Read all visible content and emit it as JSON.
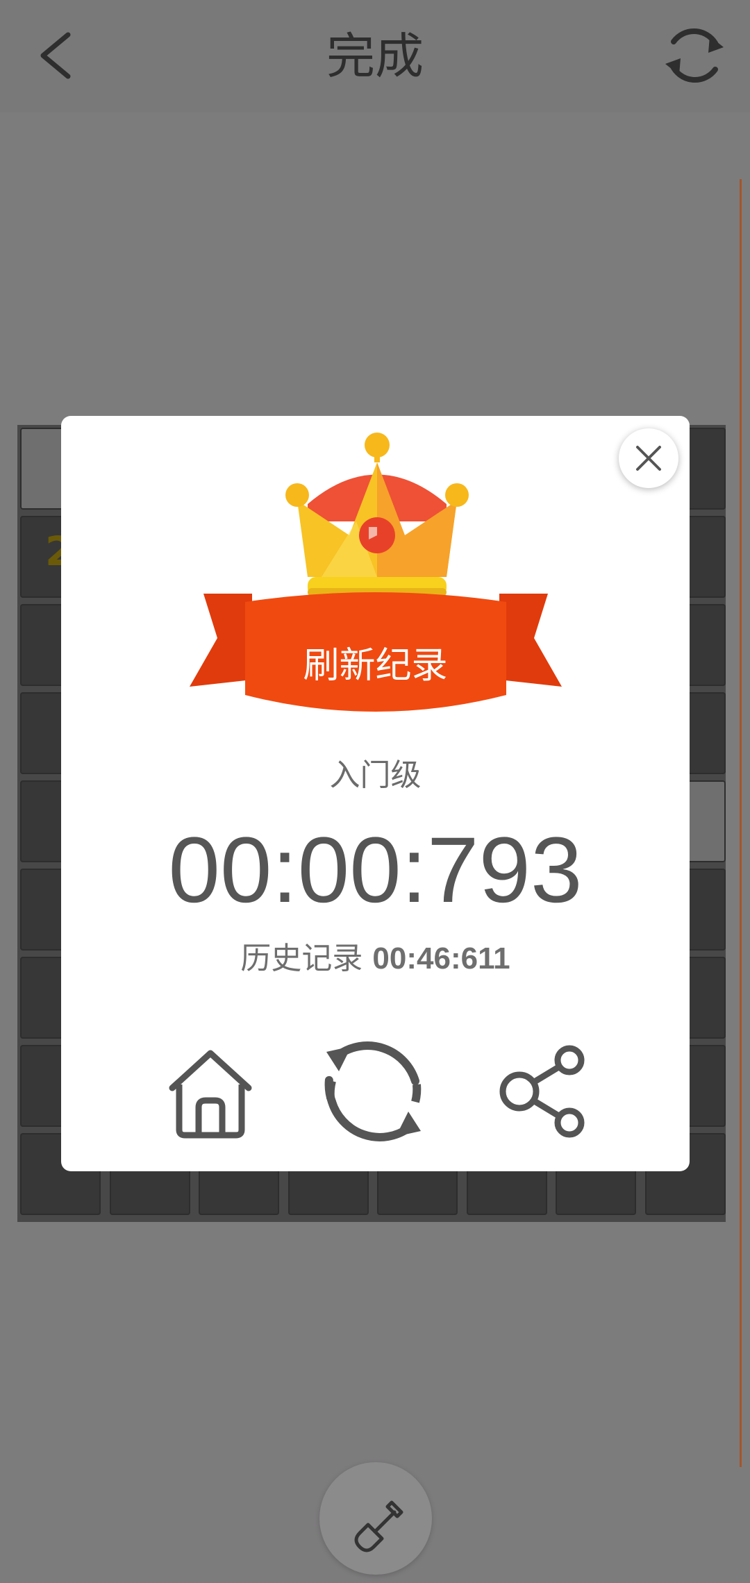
{
  "header": {
    "title": "完成",
    "back_icon": "chevron-left-icon",
    "refresh_icon": "refresh-icon"
  },
  "board": {
    "visible_number": "2",
    "colors": {
      "covered": "#373737",
      "opened": "#6f6f6f",
      "frame": "#484848"
    }
  },
  "dialog": {
    "ribbon_text": "刷新纪录",
    "level": "入门级",
    "time": "00:00:793",
    "history_label": "历史记录",
    "history_value": "00:46:611",
    "close_icon": "close-icon",
    "actions": [
      {
        "name": "home",
        "icon": "home-icon"
      },
      {
        "name": "replay",
        "icon": "replay-icon"
      },
      {
        "name": "share",
        "icon": "share-icon"
      }
    ],
    "colors": {
      "ribbon": "#f04a10",
      "crown": "#f7b81c",
      "crown_top": "#ee5136"
    }
  },
  "bottom": {
    "dig_icon": "shovel-icon"
  }
}
